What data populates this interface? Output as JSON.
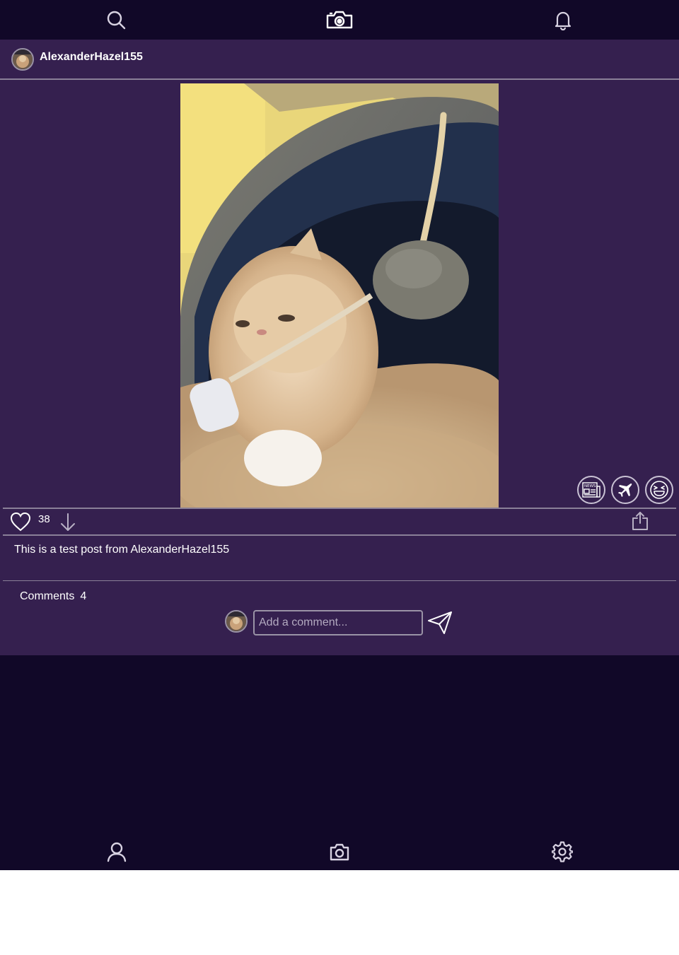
{
  "top_nav": {
    "icons": [
      "search-icon",
      "camera-icon",
      "bell-icon"
    ]
  },
  "post": {
    "username": "AlexanderHazel155",
    "like_count": "38",
    "caption": "This is a test post from AlexanderHazel155",
    "comments_label": "Comments",
    "comments_count": "4",
    "reactions": [
      "news-icon",
      "airplane-icon",
      "laughing-face-icon"
    ]
  },
  "comment_box": {
    "placeholder": "Add a comment..."
  },
  "bottom_nav": {
    "icons": [
      "user-icon",
      "camera-icon",
      "gear-icon"
    ]
  },
  "colors": {
    "background": "#110828",
    "card": "#35204f",
    "divider": "#8a8098",
    "text": "#ffffff"
  }
}
